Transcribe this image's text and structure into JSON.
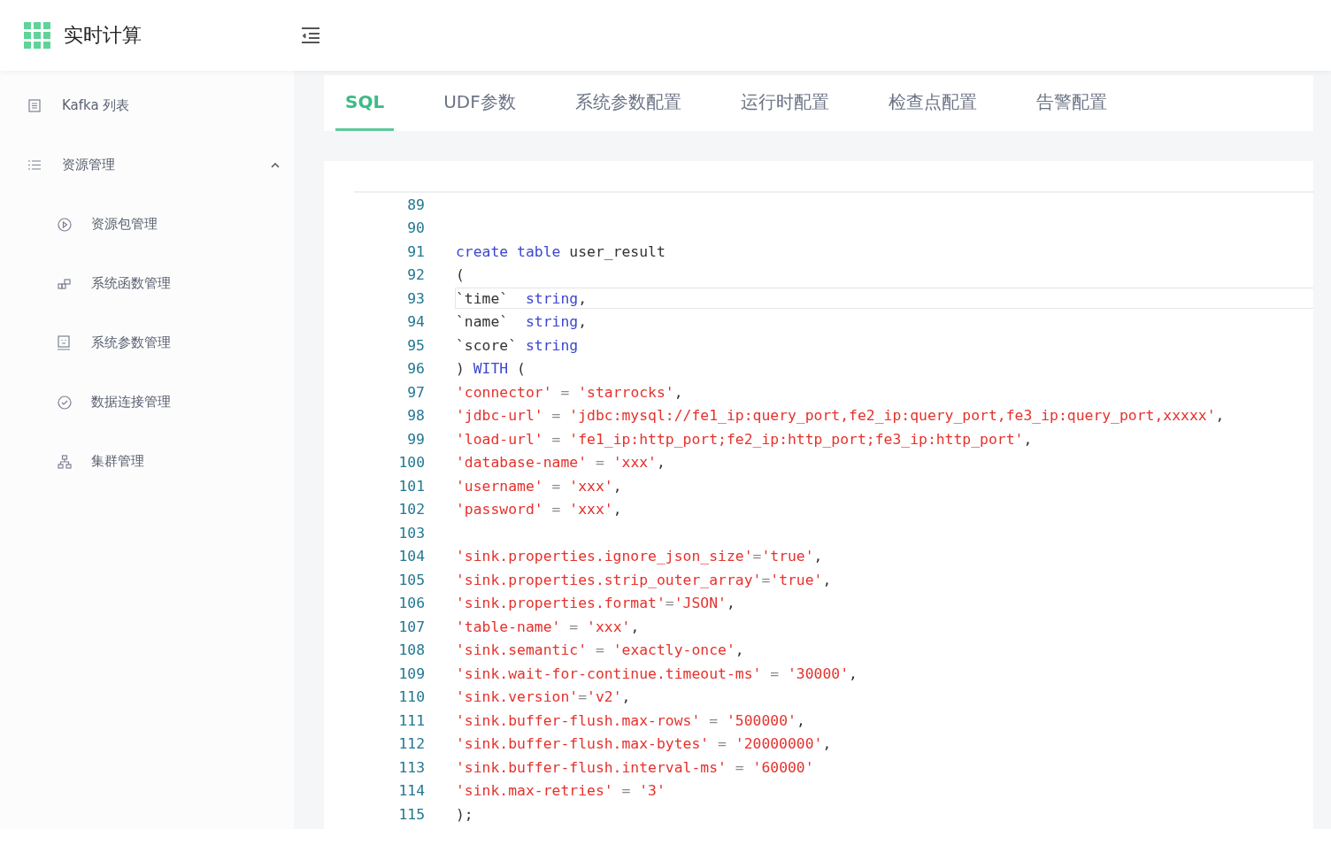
{
  "header": {
    "title": "实时计算"
  },
  "sidebar": {
    "items": [
      {
        "label": "Kafka 列表"
      },
      {
        "label": "资源管理",
        "expanded": true,
        "children": [
          {
            "label": "资源包管理"
          },
          {
            "label": "系统函数管理"
          },
          {
            "label": "系统参数管理"
          },
          {
            "label": "数据连接管理"
          },
          {
            "label": "集群管理"
          }
        ]
      }
    ]
  },
  "tabs": [
    {
      "label": "SQL",
      "selected": true
    },
    {
      "label": "UDF参数",
      "selected": false
    },
    {
      "label": "系统参数配置",
      "selected": false
    },
    {
      "label": "运行时配置",
      "selected": false
    },
    {
      "label": "检查点配置",
      "selected": false
    },
    {
      "label": "告警配置",
      "selected": false
    }
  ],
  "editor": {
    "lines": [
      {
        "number": "89",
        "current": false
      },
      {
        "number": "90",
        "current": false
      },
      {
        "number": "91",
        "current": false,
        "tokens": [
          {
            "kind": "keyword",
            "text": "create table"
          },
          {
            "kind": "plain",
            "text": " user_result"
          }
        ]
      },
      {
        "number": "92",
        "current": false,
        "tokens": [
          {
            "kind": "plain",
            "text": "("
          }
        ]
      },
      {
        "number": "93",
        "current": true,
        "tokens": [
          {
            "kind": "plain",
            "text": "`time`  "
          },
          {
            "kind": "keyword",
            "text": "string"
          },
          {
            "kind": "plain",
            "text": ","
          }
        ]
      },
      {
        "number": "94",
        "current": false,
        "tokens": [
          {
            "kind": "plain",
            "text": "`name`  "
          },
          {
            "kind": "keyword",
            "text": "string"
          },
          {
            "kind": "plain",
            "text": ","
          }
        ]
      },
      {
        "number": "95",
        "current": false,
        "tokens": [
          {
            "kind": "plain",
            "text": "`score` "
          },
          {
            "kind": "keyword",
            "text": "string"
          }
        ]
      },
      {
        "number": "96",
        "current": false,
        "tokens": [
          {
            "kind": "plain",
            "text": ") "
          },
          {
            "kind": "keyword",
            "text": "WITH"
          },
          {
            "kind": "plain",
            "text": " ("
          }
        ]
      },
      {
        "number": "97",
        "current": false,
        "tokens": [
          {
            "kind": "string",
            "text": "'connector'"
          },
          {
            "kind": "operator",
            "text": " = "
          },
          {
            "kind": "string",
            "text": "'starrocks'"
          },
          {
            "kind": "plain",
            "text": ","
          }
        ]
      },
      {
        "number": "98",
        "current": false,
        "tokens": [
          {
            "kind": "string",
            "text": "'jdbc-url'"
          },
          {
            "kind": "operator",
            "text": " = "
          },
          {
            "kind": "string",
            "text": "'jdbc:mysql://fe1_ip:query_port,fe2_ip:query_port,fe3_ip:query_port,xxxxx'"
          },
          {
            "kind": "plain",
            "text": ","
          }
        ]
      },
      {
        "number": "99",
        "current": false,
        "tokens": [
          {
            "kind": "string",
            "text": "'load-url'"
          },
          {
            "kind": "operator",
            "text": " = "
          },
          {
            "kind": "string",
            "text": "'fe1_ip:http_port;fe2_ip:http_port;fe3_ip:http_port'"
          },
          {
            "kind": "plain",
            "text": ","
          }
        ]
      },
      {
        "number": "100",
        "current": false,
        "tokens": [
          {
            "kind": "string",
            "text": "'database-name'"
          },
          {
            "kind": "operator",
            "text": " = "
          },
          {
            "kind": "string",
            "text": "'xxx'"
          },
          {
            "kind": "plain",
            "text": ","
          }
        ]
      },
      {
        "number": "101",
        "current": false,
        "tokens": [
          {
            "kind": "string",
            "text": "'username'"
          },
          {
            "kind": "operator",
            "text": " = "
          },
          {
            "kind": "string",
            "text": "'xxx'"
          },
          {
            "kind": "plain",
            "text": ","
          }
        ]
      },
      {
        "number": "102",
        "current": false,
        "tokens": [
          {
            "kind": "string",
            "text": "'password'"
          },
          {
            "kind": "operator",
            "text": " = "
          },
          {
            "kind": "string",
            "text": "'xxx'"
          },
          {
            "kind": "plain",
            "text": ","
          }
        ]
      },
      {
        "number": "103",
        "current": false
      },
      {
        "number": "104",
        "current": false,
        "tokens": [
          {
            "kind": "string",
            "text": "'sink.properties.ignore_json_size'"
          },
          {
            "kind": "operator",
            "text": "="
          },
          {
            "kind": "string",
            "text": "'true'"
          },
          {
            "kind": "plain",
            "text": ","
          }
        ]
      },
      {
        "number": "105",
        "current": false,
        "tokens": [
          {
            "kind": "string",
            "text": "'sink.properties.strip_outer_array'"
          },
          {
            "kind": "operator",
            "text": "="
          },
          {
            "kind": "string",
            "text": "'true'"
          },
          {
            "kind": "plain",
            "text": ","
          }
        ]
      },
      {
        "number": "106",
        "current": false,
        "tokens": [
          {
            "kind": "string",
            "text": "'sink.properties.format'"
          },
          {
            "kind": "operator",
            "text": "="
          },
          {
            "kind": "string",
            "text": "'JSON'"
          },
          {
            "kind": "plain",
            "text": ","
          }
        ]
      },
      {
        "number": "107",
        "current": false,
        "tokens": [
          {
            "kind": "string",
            "text": "'table-name'"
          },
          {
            "kind": "operator",
            "text": " = "
          },
          {
            "kind": "string",
            "text": "'xxx'"
          },
          {
            "kind": "plain",
            "text": ","
          }
        ]
      },
      {
        "number": "108",
        "current": false,
        "tokens": [
          {
            "kind": "string",
            "text": "'sink.semantic'"
          },
          {
            "kind": "operator",
            "text": " = "
          },
          {
            "kind": "string",
            "text": "'exactly-once'"
          },
          {
            "kind": "plain",
            "text": ","
          }
        ]
      },
      {
        "number": "109",
        "current": false,
        "tokens": [
          {
            "kind": "string",
            "text": "'sink.wait-for-continue.timeout-ms'"
          },
          {
            "kind": "operator",
            "text": " = "
          },
          {
            "kind": "string",
            "text": "'30000'"
          },
          {
            "kind": "plain",
            "text": ","
          }
        ]
      },
      {
        "number": "110",
        "current": false,
        "tokens": [
          {
            "kind": "string",
            "text": "'sink.version'"
          },
          {
            "kind": "operator",
            "text": "="
          },
          {
            "kind": "string",
            "text": "'v2'"
          },
          {
            "kind": "plain",
            "text": ","
          }
        ]
      },
      {
        "number": "111",
        "current": false,
        "tokens": [
          {
            "kind": "string",
            "text": "'sink.buffer-flush.max-rows'"
          },
          {
            "kind": "operator",
            "text": " = "
          },
          {
            "kind": "string",
            "text": "'500000'"
          },
          {
            "kind": "plain",
            "text": ","
          }
        ]
      },
      {
        "number": "112",
        "current": false,
        "tokens": [
          {
            "kind": "string",
            "text": "'sink.buffer-flush.max-bytes'"
          },
          {
            "kind": "operator",
            "text": " = "
          },
          {
            "kind": "string",
            "text": "'20000000'"
          },
          {
            "kind": "plain",
            "text": ","
          }
        ]
      },
      {
        "number": "113",
        "current": false,
        "tokens": [
          {
            "kind": "string",
            "text": "'sink.buffer-flush.interval-ms'"
          },
          {
            "kind": "operator",
            "text": " = "
          },
          {
            "kind": "string",
            "text": "'60000'"
          }
        ]
      },
      {
        "number": "114",
        "current": false,
        "tokens": [
          {
            "kind": "string",
            "text": "'sink.max-retries'"
          },
          {
            "kind": "operator",
            "text": " = "
          },
          {
            "kind": "string",
            "text": "'3'"
          }
        ]
      },
      {
        "number": "115",
        "current": false,
        "tokens": [
          {
            "kind": "plain",
            "text": ");"
          }
        ]
      }
    ]
  }
}
